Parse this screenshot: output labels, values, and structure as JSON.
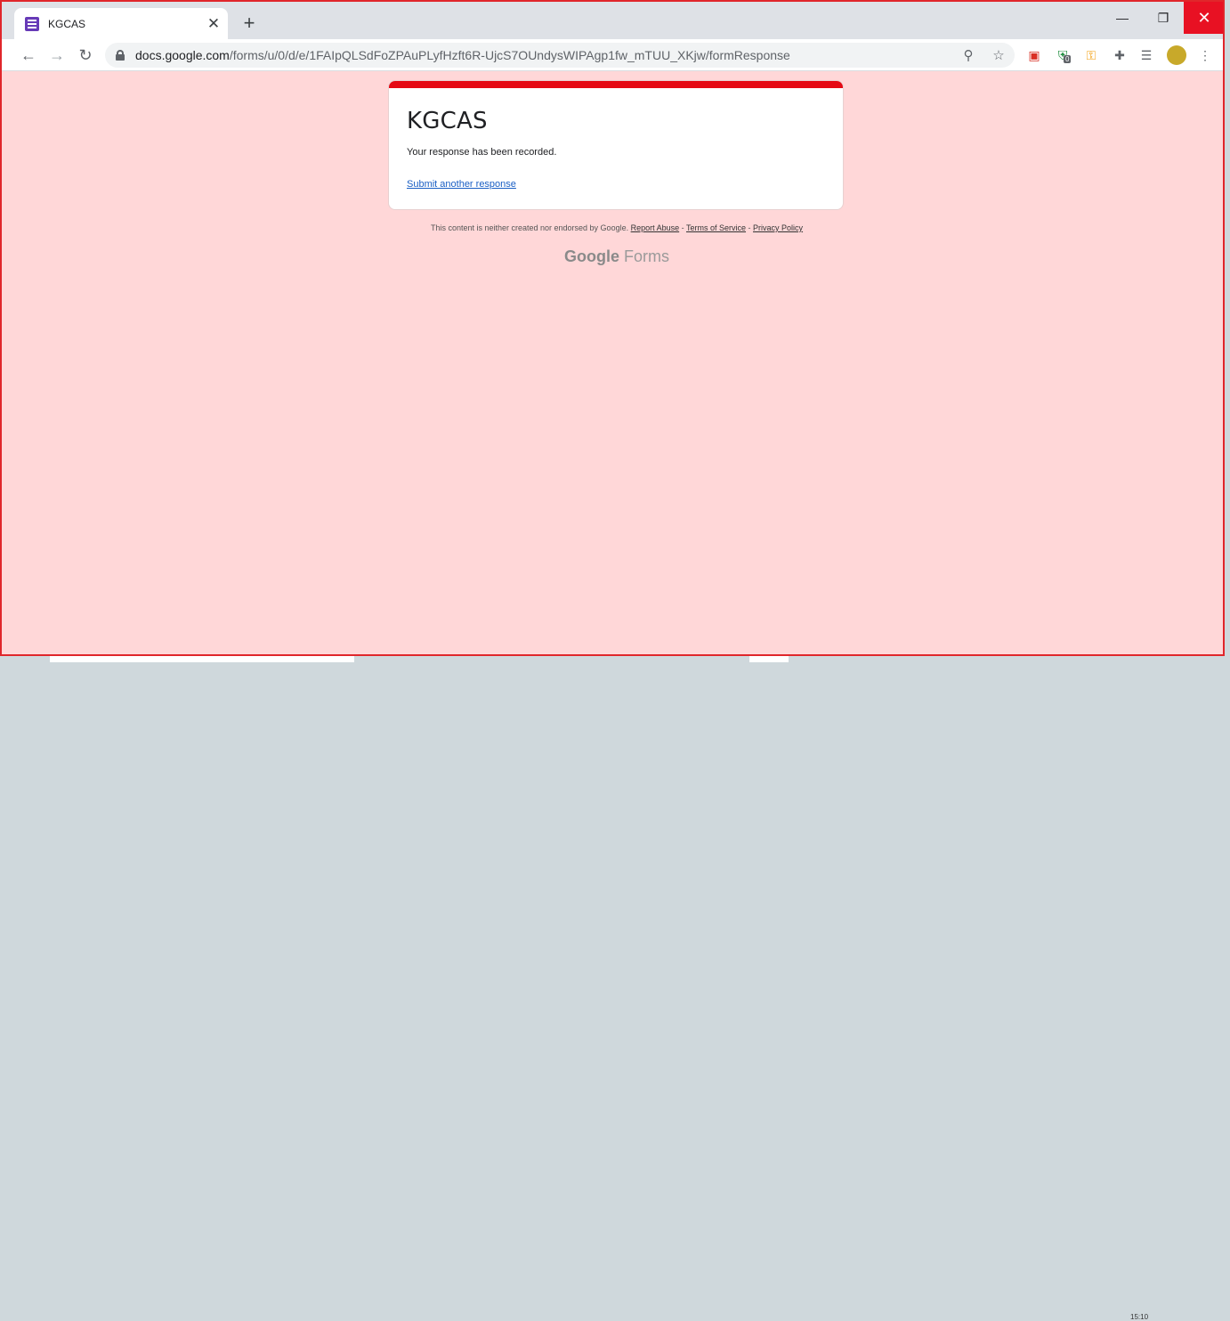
{
  "browser": {
    "tab": {
      "title": "KGCAS",
      "favicon": "google-forms-icon"
    },
    "new_tab_label": "+",
    "url_host": "docs.google.com",
    "url_path": "/forms/u/0/d/e/1FAIpQLSdFoZPAuPLyfHzft6R-UjcS7OUndysWIPAgp1fw_mTUU_XKjw/formResponse",
    "extensions": [
      "zoom-icon",
      "star-icon",
      "pocket-icon",
      "shield-icon",
      "key-icon",
      "puzzle-icon",
      "reading-list-icon",
      "profile-avatar",
      "menu-icon"
    ],
    "extension_badge": "0"
  },
  "form": {
    "title": "KGCAS",
    "confirmation": "Your response has been recorded.",
    "submit_another": "Submit another response",
    "accent_color": "#e50914",
    "background_color": "#ffd7d8"
  },
  "footer": {
    "disclaimer": "This content is neither created nor endorsed by Google.",
    "report_abuse": "Report Abuse",
    "separator": " - ",
    "terms": "Terms of Service",
    "privacy": "Privacy Policy",
    "brand_google": "Google",
    "brand_forms": "Forms"
  },
  "taskbar": {
    "time": "15:10"
  }
}
